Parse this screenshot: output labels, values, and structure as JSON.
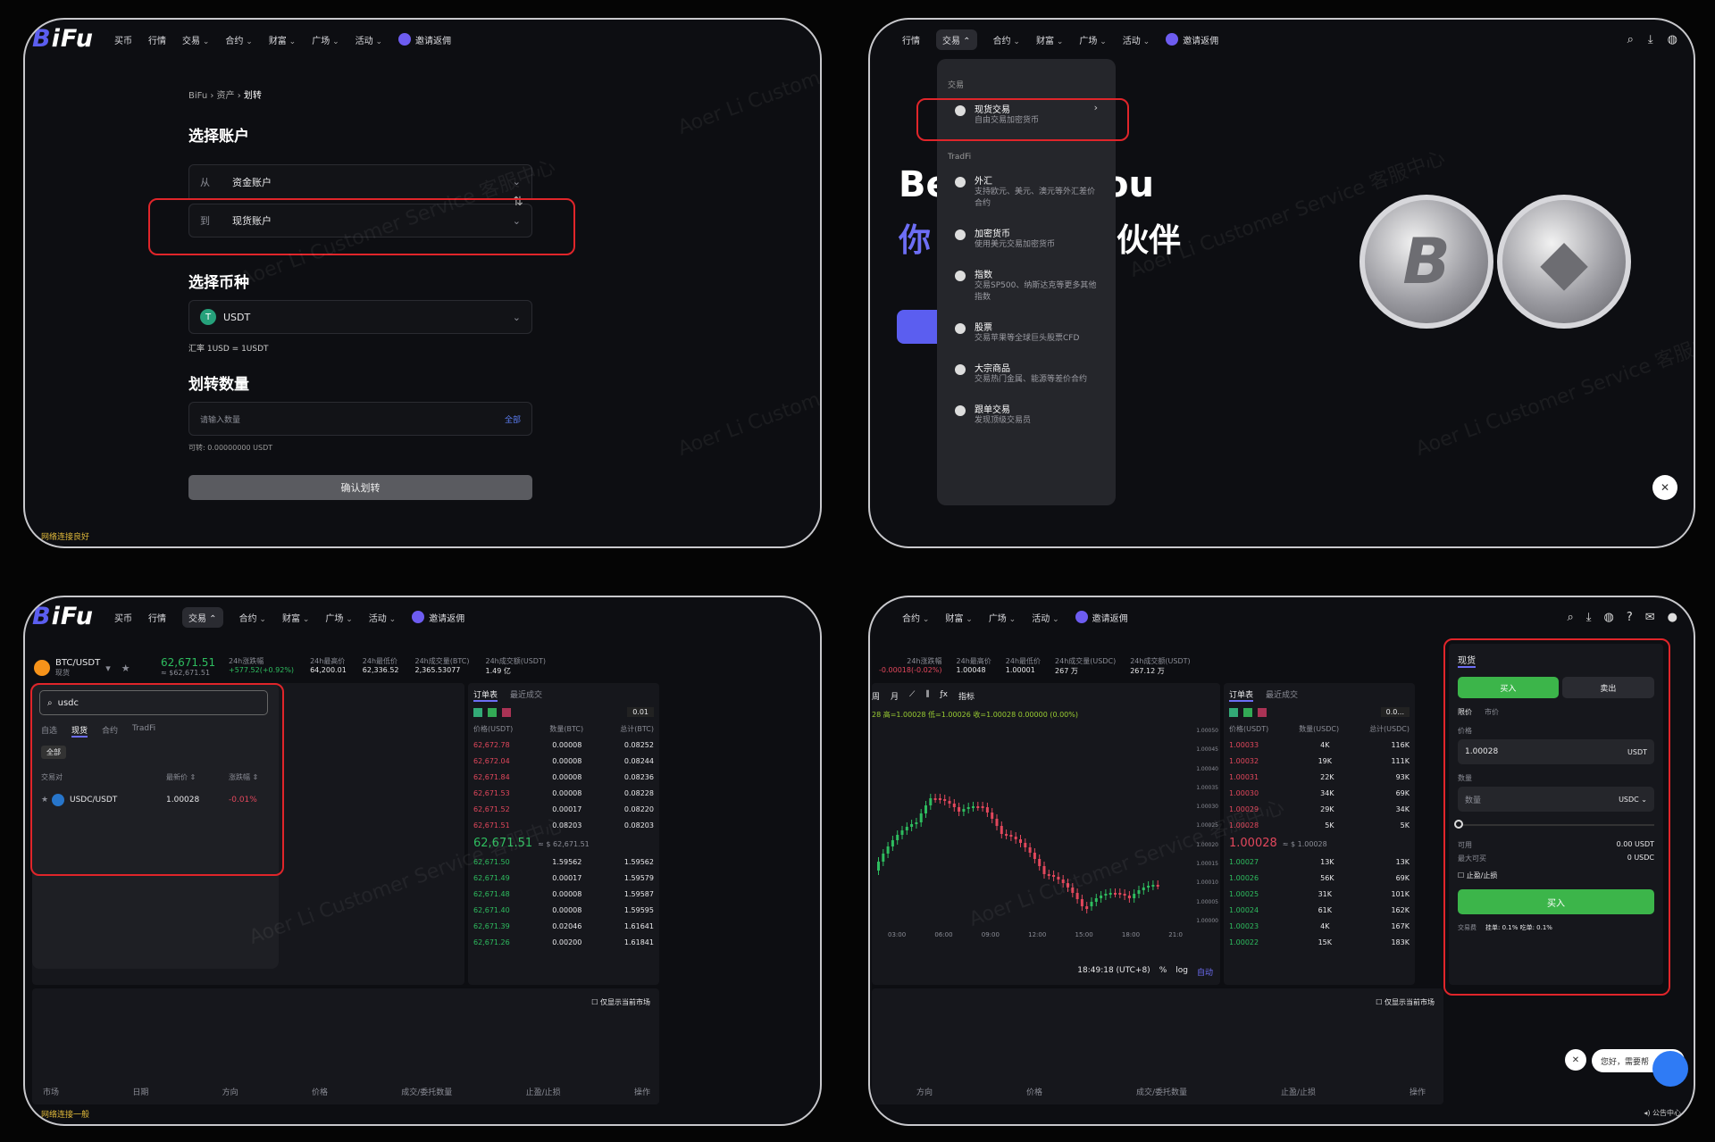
{
  "nav": {
    "logo_b": "B",
    "logo_rest": "iFu",
    "items": [
      "买币",
      "行情",
      "交易",
      "合约",
      "财富",
      "广场",
      "活动"
    ],
    "invite": "邀请返佣",
    "items_p2": [
      "行情",
      "交易",
      "合约",
      "财富",
      "广场",
      "活动"
    ],
    "items_p4": [
      "合约",
      "财富",
      "广场",
      "活动"
    ]
  },
  "watermark": "Aoer Li Customer Service 客服中心",
  "transfer": {
    "breadcrumb": [
      "BiFu",
      "资产",
      "划转"
    ],
    "select_account": "选择账户",
    "from_label": "从",
    "from_value": "资金账户",
    "to_label": "到",
    "to_value": "现货账户",
    "select_coin": "选择币种",
    "coin": "USDT",
    "coin_icon": "T",
    "rate": "汇率 1USD = 1USDT",
    "amount_title": "划转数量",
    "amount_placeholder": "请输入数量",
    "all": "全部",
    "available": "可转: 0.00000000 USDT",
    "confirm": "确认划转",
    "status": "网络连接良好"
  },
  "menu": {
    "section1": "交易",
    "items1": [
      {
        "t": "现货交易",
        "d": "自由交易加密货币"
      }
    ],
    "section2": "TradFi",
    "items2": [
      {
        "t": "外汇",
        "d": "支持欧元、美元、澳元等外汇差价合约"
      },
      {
        "t": "加密货币",
        "d": "使用美元交易加密货币"
      },
      {
        "t": "指数",
        "d": "交易SP500、纳斯达克等更多其他指数"
      },
      {
        "t": "股票",
        "d": "交易苹果等全球巨头股票CFD"
      },
      {
        "t": "大宗商品",
        "d": "交易热门金属、能源等差价合约"
      },
      {
        "t": "跟单交易",
        "d": "发现顶级交易员"
      }
    ],
    "hero1": "Be",
    "hero2": "ou",
    "hero3": "你",
    "hero4": "伙伴"
  },
  "spot": {
    "pair": "BTC/USDT",
    "pair_sub": "现货",
    "price": "62,671.51",
    "price_sub": "≈ $62,671.51",
    "stats": [
      {
        "k": "24h涨跌幅",
        "v": "+577.52(+0.92%)"
      },
      {
        "k": "24h最高价",
        "v": "64,200.01"
      },
      {
        "k": "24h最低价",
        "v": "62,336.52"
      },
      {
        "k": "24h成交量(BTC)",
        "v": "2,365.53077"
      },
      {
        "k": "24h成交额(USDT)",
        "v": "1.49 亿"
      }
    ],
    "search": "usdc",
    "tabs": [
      "自选",
      "现货",
      "合约",
      "TradFi"
    ],
    "all": "全部",
    "col_pair": "交易对",
    "col_price": "最新价 ⇕",
    "col_change": "涨跌幅 ⇕",
    "result_pair": "USDC/USDT",
    "result_price": "1.00028",
    "result_change": "-0.01%",
    "ob_tabs": [
      "订单表",
      "最近成交"
    ],
    "ob_prec": "0.01",
    "ob_cols": [
      "价格(USDT)",
      "数量(BTC)",
      "总计(BTC)"
    ],
    "asks": [
      [
        "62,672.78",
        "0.00008",
        "0.08252"
      ],
      [
        "62,672.04",
        "0.00008",
        "0.08244"
      ],
      [
        "62,671.84",
        "0.00008",
        "0.08236"
      ],
      [
        "62,671.53",
        "0.00008",
        "0.08228"
      ],
      [
        "62,671.52",
        "0.00017",
        "0.08220"
      ],
      [
        "62,671.51",
        "0.08203",
        "0.08203"
      ]
    ],
    "mid": "62,671.51",
    "mid_sub": "≈ $ 62,671.51",
    "bids": [
      [
        "62,671.50",
        "1.59562",
        "1.59562"
      ],
      [
        "62,671.49",
        "0.00017",
        "1.59579"
      ],
      [
        "62,671.48",
        "0.00008",
        "1.59587"
      ],
      [
        "62,671.40",
        "0.00008",
        "1.59595"
      ],
      [
        "62,671.39",
        "0.02046",
        "1.61641"
      ],
      [
        "62,671.26",
        "0.00200",
        "1.61841"
      ]
    ],
    "only_current": "仅显示当前市场",
    "order_cols": [
      "市场",
      "日期",
      "方向",
      "价格",
      "成交/委托数量",
      "止盈/止损",
      "操作"
    ],
    "status": "网络连接一般"
  },
  "usdc": {
    "stats": [
      {
        "k": "24h涨跌幅",
        "v": "-0.00018(-0.02%)"
      },
      {
        "k": "24h最高价",
        "v": "1.00048"
      },
      {
        "k": "24h最低价",
        "v": "1.00001"
      },
      {
        "k": "24h成交量(USDC)",
        "v": "267 万"
      },
      {
        "k": "24h成交额(USDT)",
        "v": "267.12 万"
      }
    ],
    "chart_tb": [
      "周",
      "月",
      "指标"
    ],
    "ohlc": "28 高=1.00028 低=1.00026 收=1.00028 0.00000 (0.00%)",
    "time": "18:49:18 (UTC+8)",
    "scale": [
      "%",
      "log",
      "自动"
    ],
    "times": [
      "03:00",
      "06:00",
      "09:00",
      "12:00",
      "15:00",
      "18:00",
      "21:0"
    ],
    "yticks": [
      "1.00050",
      "1.00045",
      "1.00040",
      "1.00035",
      "1.00030",
      "1.00025",
      "1.00020",
      "1.00015",
      "1.00010",
      "1.00005",
      "1.00000"
    ],
    "last_tick": "1.00028",
    "ob_cols": [
      "价格(USDT)",
      "数量(USDC)",
      "总计(USDC)"
    ],
    "ob_prec": "0.0...",
    "asks": [
      [
        "1.00033",
        "4K",
        "116K"
      ],
      [
        "1.00032",
        "19K",
        "111K"
      ],
      [
        "1.00031",
        "22K",
        "93K"
      ],
      [
        "1.00030",
        "34K",
        "69K"
      ],
      [
        "1.00029",
        "29K",
        "34K"
      ],
      [
        "1.00028",
        "5K",
        "5K"
      ]
    ],
    "mid": "1.00028",
    "mid_sub": "≈ $ 1.00028",
    "bids": [
      [
        "1.00027",
        "13K",
        "13K"
      ],
      [
        "1.00026",
        "56K",
        "69K"
      ],
      [
        "1.00025",
        "31K",
        "101K"
      ],
      [
        "1.00024",
        "61K",
        "162K"
      ],
      [
        "1.00023",
        "4K",
        "167K"
      ],
      [
        "1.00022",
        "15K",
        "183K"
      ]
    ],
    "form": {
      "title": "现货",
      "buy": "买入",
      "sell": "卖出",
      "limit": "限价",
      "market": "市价",
      "price_label": "价格",
      "price": "1.00028",
      "price_unit": "USDT",
      "qty_label": "数量",
      "qty_ph": "数量",
      "qty_unit": "USDC ⌄",
      "avail_label": "可用",
      "avail": "0.00 USDT",
      "max_label": "最大可买",
      "max": "0 USDC",
      "tpsl": "止盈/止损",
      "submit": "买入",
      "fee_label": "交易费",
      "fee": "挂单: 0.1%   吃单: 0.1%"
    },
    "order_cols": [
      "方向",
      "价格",
      "成交/委托数量",
      "止盈/止损",
      "操作"
    ],
    "chat": "您好，需要帮",
    "notice": "公告中心",
    "only_current": "仅显示当前市场"
  }
}
